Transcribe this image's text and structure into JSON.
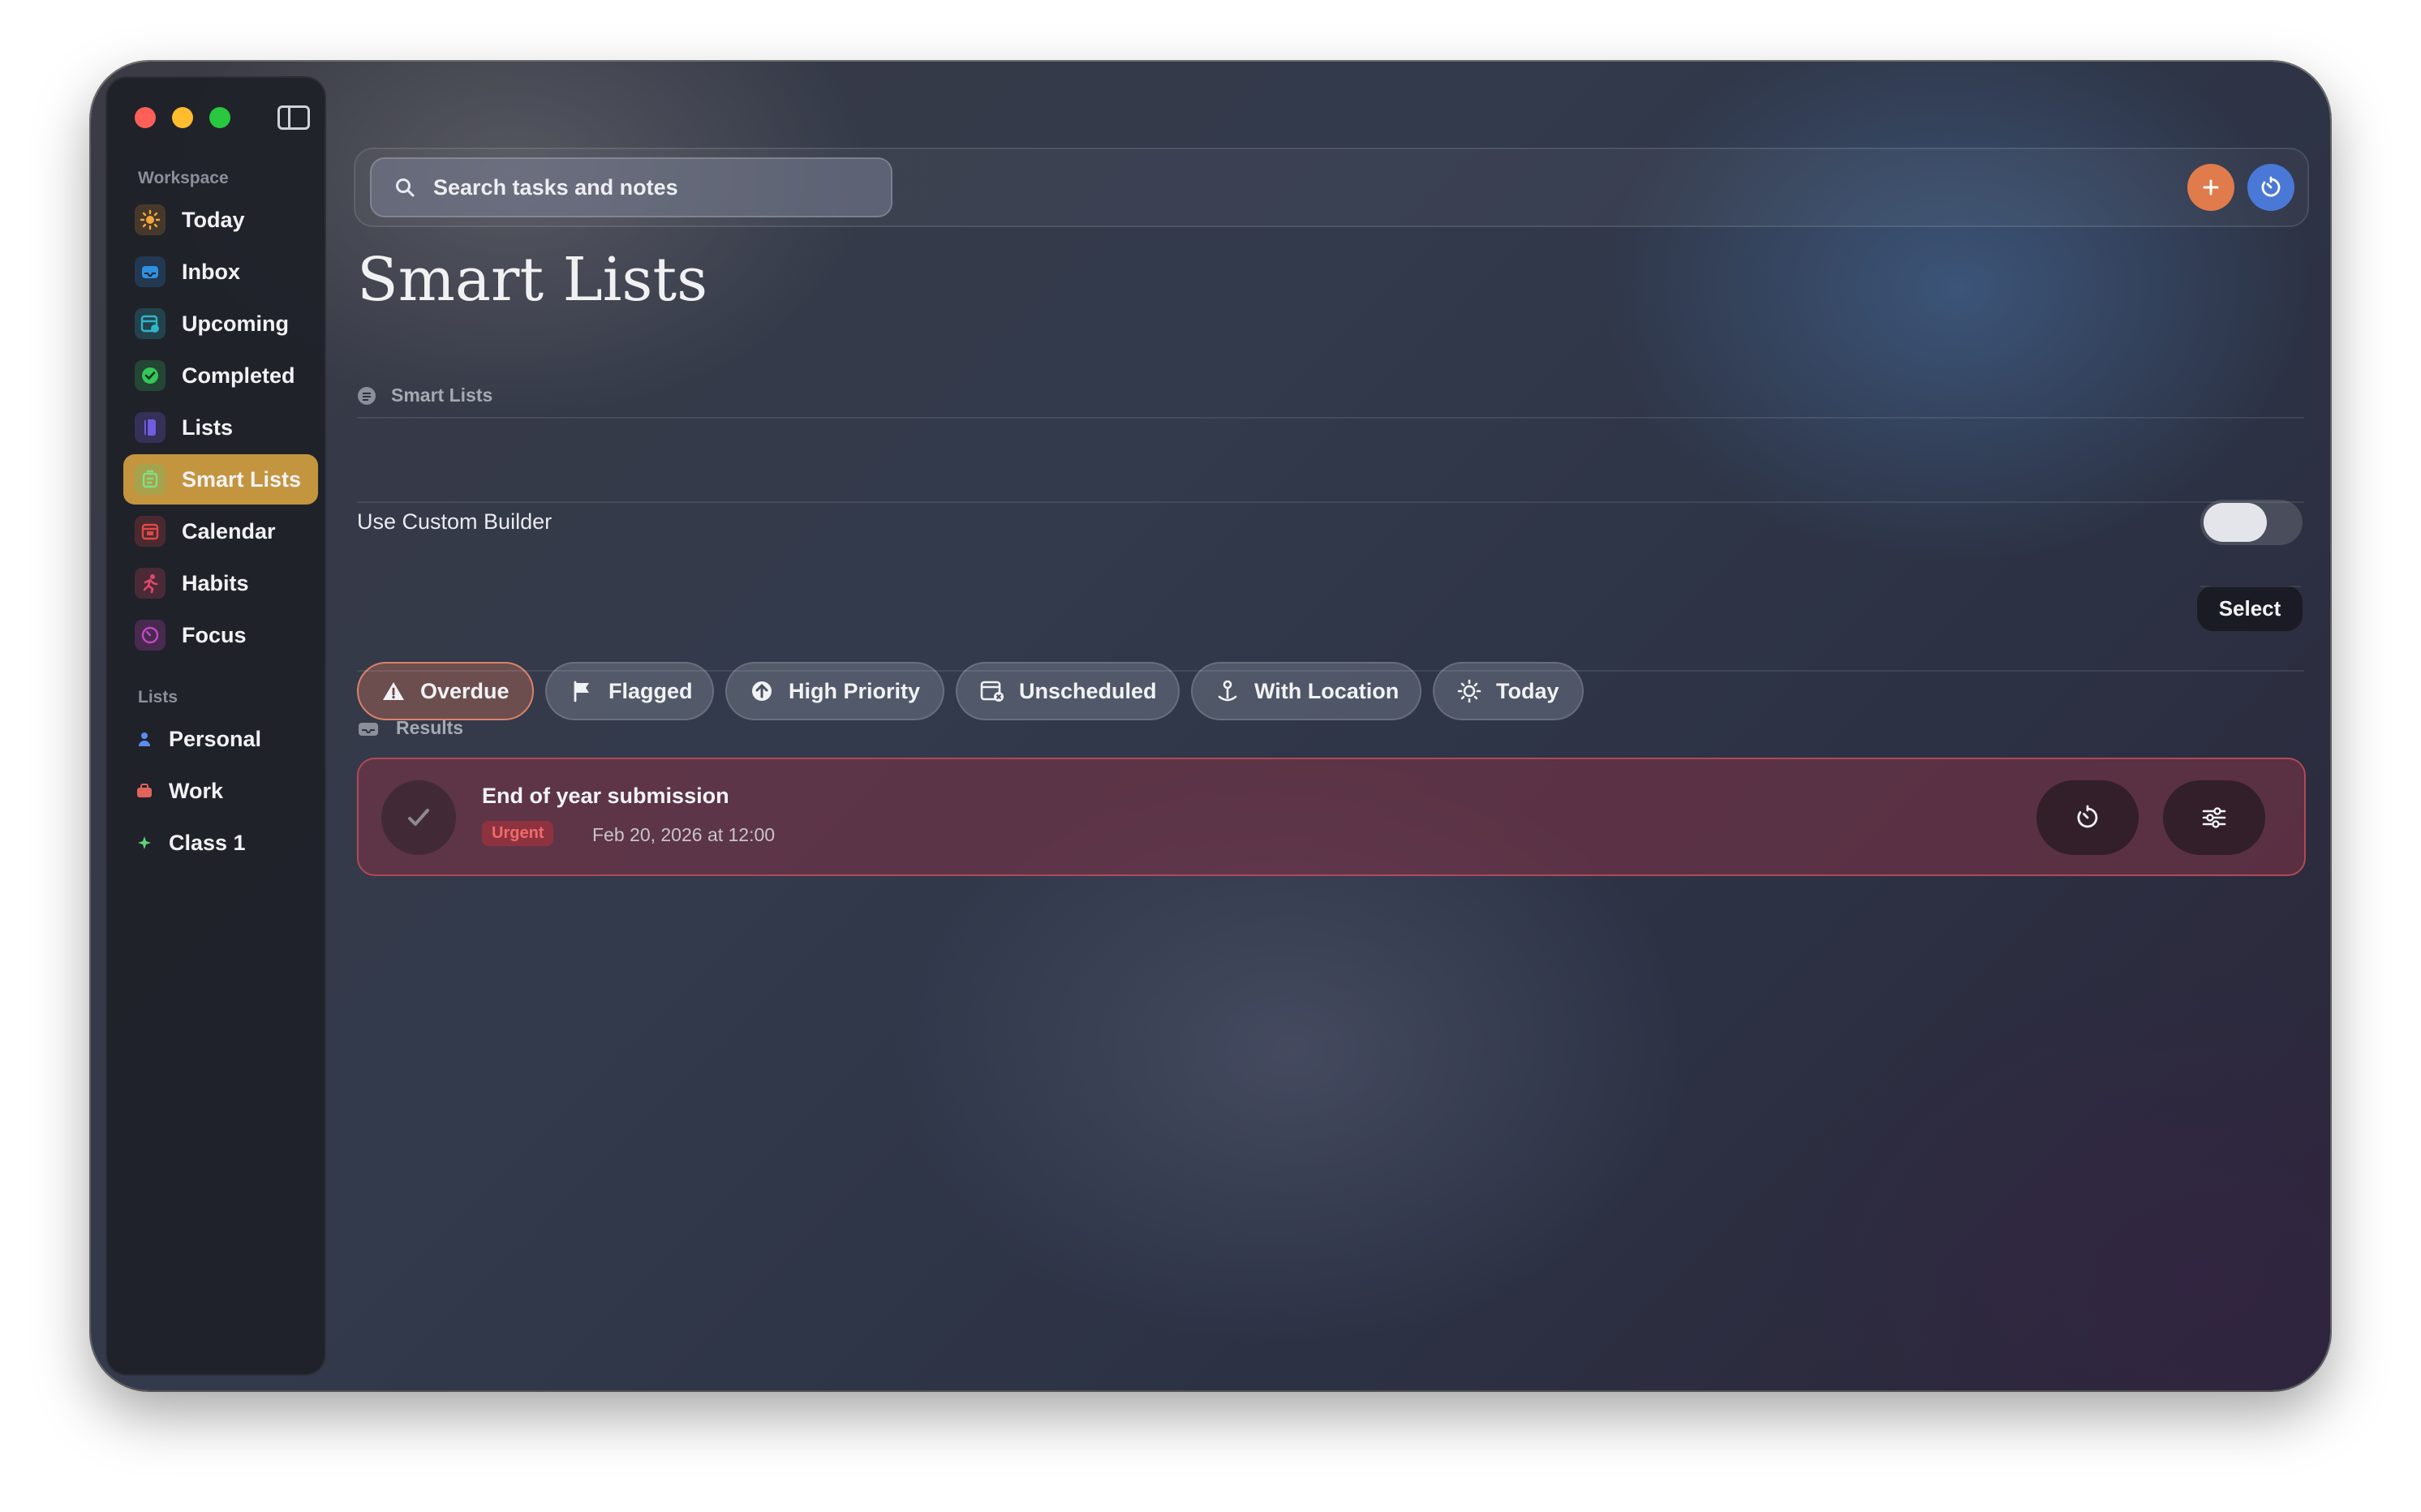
{
  "sidebar": {
    "workspace_label": "Workspace",
    "workspace_items": [
      {
        "label": "Today",
        "icon": "sun-icon",
        "color": "#f4a63a"
      },
      {
        "label": "Inbox",
        "icon": "inbox-icon",
        "color": "#2f8fe0"
      },
      {
        "label": "Upcoming",
        "icon": "calendar-clock-icon",
        "color": "#2fb6c9"
      },
      {
        "label": "Completed",
        "icon": "check-badge-icon",
        "color": "#34c759"
      },
      {
        "label": "Lists",
        "icon": "book-icon",
        "color": "#6e5de0"
      },
      {
        "label": "Smart Lists",
        "icon": "smart-list-icon",
        "color": "#5fc46f"
      },
      {
        "label": "Calendar",
        "icon": "calendar-icon",
        "color": "#e04848"
      },
      {
        "label": "Habits",
        "icon": "runner-icon",
        "color": "#e0486a"
      },
      {
        "label": "Focus",
        "icon": "timer-icon",
        "color": "#c447c4"
      }
    ],
    "active_item": "Smart Lists",
    "lists_label": "Lists",
    "lists": [
      {
        "label": "Personal",
        "icon": "person-icon",
        "color": "#5b8cf0"
      },
      {
        "label": "Work",
        "icon": "briefcase-icon",
        "color": "#e0645a"
      },
      {
        "label": "Class 1",
        "icon": "sparkle-icon",
        "color": "#5fd47a"
      }
    ]
  },
  "topbar": {
    "search_placeholder": "Search tasks and notes",
    "add_color": "#e07b4c",
    "focus_color": "#4a78d6"
  },
  "main": {
    "title": "Smart Lists",
    "section_label": "Smart Lists",
    "custom_builder_label": "Use Custom Builder",
    "custom_builder_enabled": false,
    "select_label": "Select",
    "filters": [
      {
        "label": "Overdue",
        "icon": "warning-icon",
        "active": true
      },
      {
        "label": "Flagged",
        "icon": "flag-icon",
        "active": false
      },
      {
        "label": "High Priority",
        "icon": "arrow-up-circle-icon",
        "active": false
      },
      {
        "label": "Unscheduled",
        "icon": "calendar-x-icon",
        "active": false
      },
      {
        "label": "With Location",
        "icon": "location-pin-icon",
        "active": false
      },
      {
        "label": "Today",
        "icon": "sun-icon",
        "active": false
      }
    ],
    "results_label": "Results",
    "results": [
      {
        "title": "End of year submission",
        "badge": "Urgent",
        "due": "Feb 20, 2026 at 12:00"
      }
    ]
  }
}
